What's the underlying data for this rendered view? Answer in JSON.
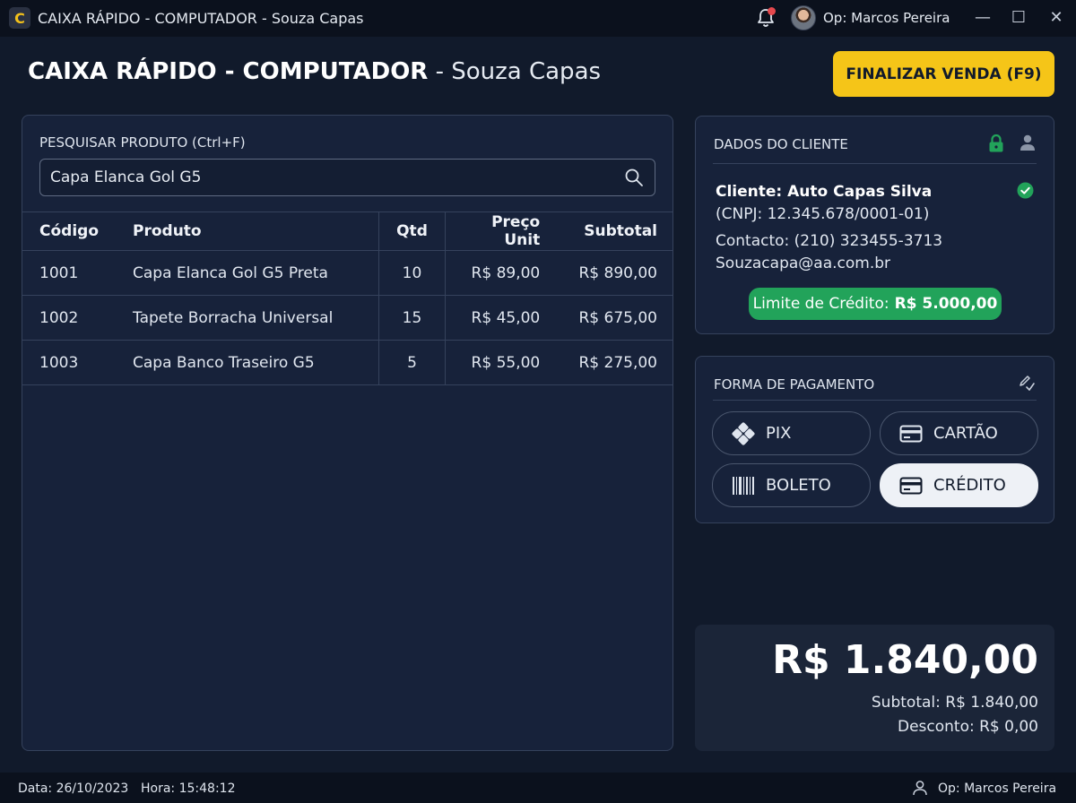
{
  "window": {
    "logo_letter": "C",
    "title": "CAIXA RÁPIDO - COMPUTADOR - Souza Capas",
    "operator": "Op: Marcos Pereira",
    "minimize": "—",
    "maximize": "☐",
    "close": "✕"
  },
  "header": {
    "title_strong": "CAIXA RÁPIDO - COMPUTADOR",
    "title_light": " - Souza Capas",
    "finalize_label": "FINALIZAR VENDA (F9)"
  },
  "search": {
    "label": "PESQUISAR PRODUTO (Ctrl+F)",
    "value": "Capa Elanca Gol G5"
  },
  "table": {
    "headers": [
      "Código",
      "Produto",
      "Qtd",
      "Preço Unit",
      "Subtotal"
    ],
    "rows": [
      [
        "1001",
        "Capa Elanca Gol G5 Preta",
        "10",
        "R$ 89,00",
        "R$ 890,00"
      ],
      [
        "1002",
        "Tapete Borracha Universal",
        "15",
        "R$ 45,00",
        "R$ 675,00"
      ],
      [
        "1003",
        "Capa Banco Traseiro G5",
        "5",
        "R$ 55,00",
        "R$ 275,00"
      ]
    ]
  },
  "customer": {
    "title": "DADOS DO CLIENTE",
    "name": "Cliente: Auto Capas Silva",
    "cnpj": "(CNPJ: 12.345.678/0001-01)",
    "contact": "Contacto: (210) 323455-3713",
    "email": "Souzacapa@aa.com.br",
    "credit_label": "Limite de Crédito:",
    "credit_value": "R$ 5.000,00"
  },
  "payment": {
    "title": "FORMA DE PAGAMENTO",
    "options": [
      {
        "label": "PIX",
        "icon": "pix-icon",
        "selected": false
      },
      {
        "label": "CARTÃO",
        "icon": "card-icon",
        "selected": false
      },
      {
        "label": "BOLETO",
        "icon": "barcode-icon",
        "selected": false
      },
      {
        "label": "CRÉDITO",
        "icon": "card-icon",
        "selected": true
      }
    ]
  },
  "totals": {
    "total": "R$ 1.840,00",
    "subtotal": "Subtotal: R$ 1.840,00",
    "discount": "Desconto: R$ 0,00"
  },
  "status": {
    "date": "Data: 26/10/2023",
    "time": "Hora: 15:48:12",
    "operator": "Op: Marcos Pereira"
  },
  "colors": {
    "background": "#111a2b",
    "panel": "#17223a",
    "accent_yellow": "#f5c518",
    "credit_green": "#22a35a",
    "notification_red": "#e5484d"
  }
}
